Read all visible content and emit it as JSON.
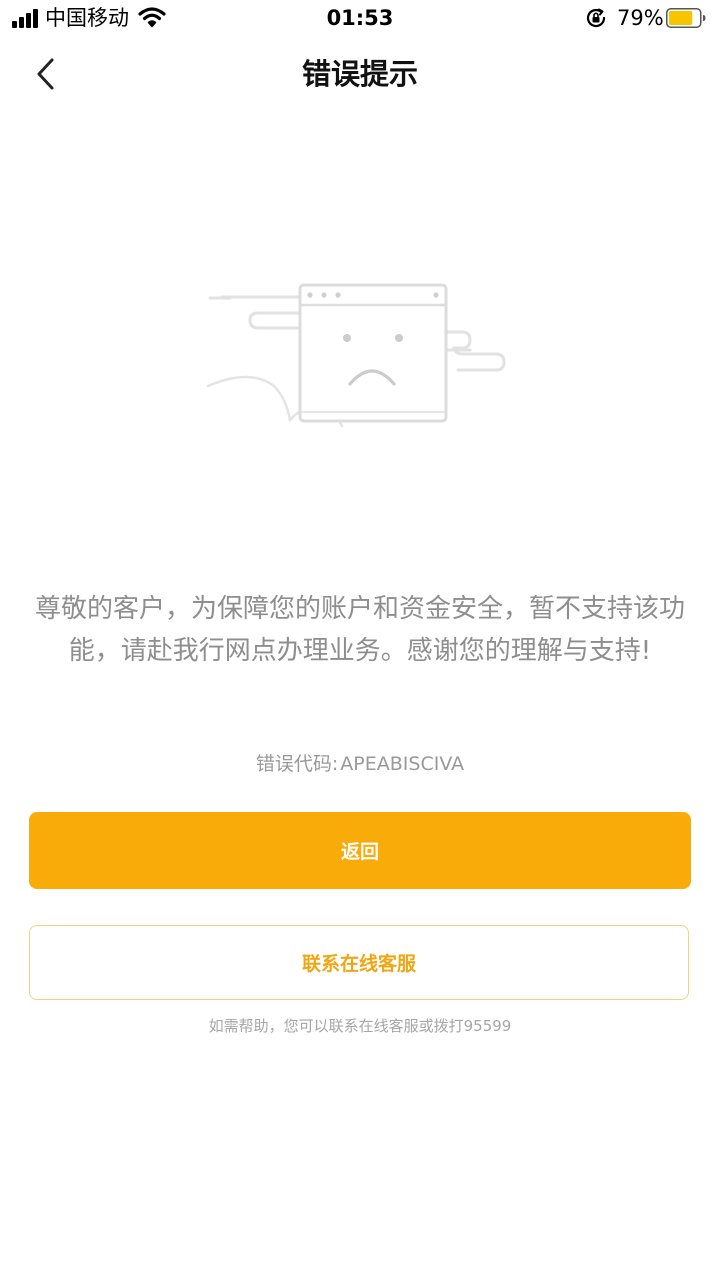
{
  "status_bar": {
    "carrier": "中国移动",
    "time": "01:53",
    "battery_percent": "79%",
    "battery_level": 0.79,
    "icons": [
      "signal-icon",
      "wifi-icon",
      "orientation-lock-icon",
      "battery-icon"
    ]
  },
  "nav": {
    "back_icon": "chevron-left-icon",
    "title": "错误提示"
  },
  "illustration": {
    "icon": "sad-browser-window-icon"
  },
  "content": {
    "message": "尊敬的客户，为保障您的账户和资金安全，暂不支持该功能，请赴我行网点办理业务。感谢您的理解与支持!",
    "error_code_label": "错误代码:",
    "error_code_value": "APEABISCIVA"
  },
  "actions": {
    "back_label": "返回",
    "contact_label": "联系在线客服"
  },
  "footer": {
    "help_text": "如需帮助，您可以联系在线客服或拨打95599"
  },
  "colors": {
    "accent": "#f8ab09",
    "accent_text": "#f0a612",
    "accent_border": "#f6cf83",
    "message_text": "#8e8e8e",
    "battery_fill": "#f7c500"
  }
}
